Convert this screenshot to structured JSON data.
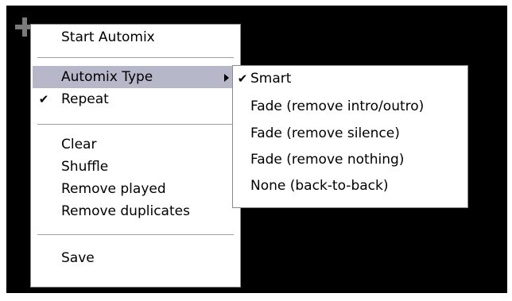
{
  "main_menu": {
    "items": [
      {
        "label": "Start Automix"
      },
      {
        "label": "Automix Type"
      },
      {
        "label": "Repeat",
        "check": "✔"
      },
      {
        "label": "Clear"
      },
      {
        "label": "Shuffle"
      },
      {
        "label": "Remove played"
      },
      {
        "label": "Remove duplicates"
      },
      {
        "label": "Save"
      }
    ]
  },
  "submenu": {
    "items": [
      {
        "label": "Smart",
        "check": "✔"
      },
      {
        "label": "Fade (remove intro/outro)"
      },
      {
        "label": "Fade (remove silence)"
      },
      {
        "label": "Fade (remove nothing)"
      },
      {
        "label": "None (back-to-back)"
      }
    ]
  },
  "colors": {
    "background": "#000000",
    "menu_background": "#ffffff",
    "highlight": "#b6b7c9",
    "plus_icon": "#7a7a7a"
  },
  "icons": [
    "plus-icon",
    "check-icon",
    "submenu-arrow-icon"
  ]
}
